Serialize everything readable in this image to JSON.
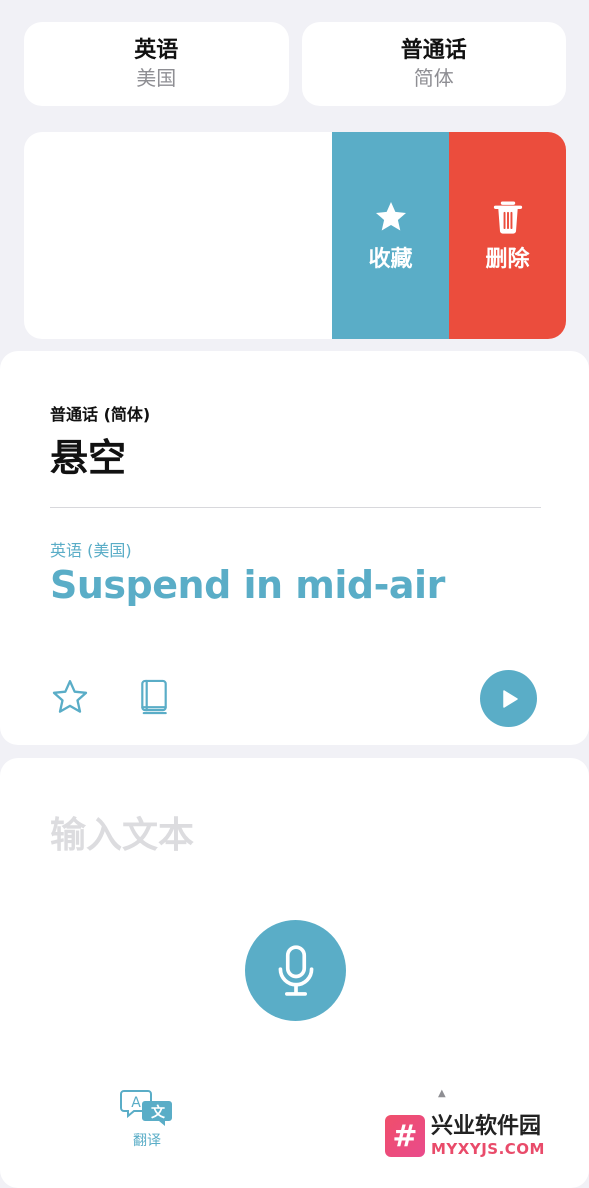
{
  "language_bar": {
    "source": {
      "name": "英语",
      "region": "美国"
    },
    "target": {
      "name": "普通话",
      "region": "简体"
    }
  },
  "swipe_actions": {
    "favorite_label": "收藏",
    "delete_label": "删除"
  },
  "result": {
    "source_language": "普通话 (简体)",
    "source_text": "悬空",
    "target_language": "英语 (美国)",
    "target_text": "Suspend in mid-air"
  },
  "input": {
    "placeholder": "输入文本",
    "value": ""
  },
  "tabbar": {
    "translate_label": "翻译",
    "translate_icon_text_a": "A",
    "translate_icon_text_b": "文"
  },
  "watermark": {
    "logo_glyph": "#",
    "title": "兴业软件园",
    "url": "MYXYJS.COM"
  },
  "colors": {
    "accent": "#5aadc7",
    "favorite": "#5aadc7",
    "delete": "#eb4d3d",
    "background": "#f1f1f6"
  }
}
